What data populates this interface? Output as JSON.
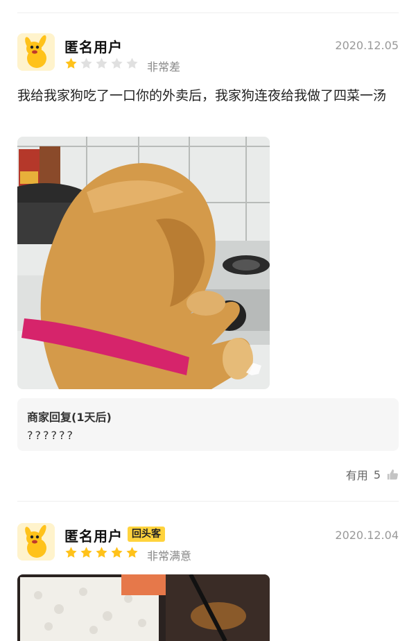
{
  "colors": {
    "star_active": "#ffc21a",
    "star_inactive": "#e0e0e0",
    "badge_bg": "#ffd33d",
    "date": "#999999"
  },
  "reviews": [
    {
      "user": "匿名用户",
      "date": "2020.12.05",
      "rating": 1,
      "rating_text": "非常差",
      "text": "我给我家狗吃了一口你的外卖后，我家狗连夜给我做了四菜一汤",
      "merchant_reply": {
        "title": "商家回复(1天后)",
        "content": "??????"
      },
      "useful_label": "有用",
      "useful_count": "5"
    },
    {
      "user": "匿名用户",
      "badge": "回头客",
      "date": "2020.12.04",
      "rating": 5,
      "rating_text": "非常满意"
    }
  ]
}
